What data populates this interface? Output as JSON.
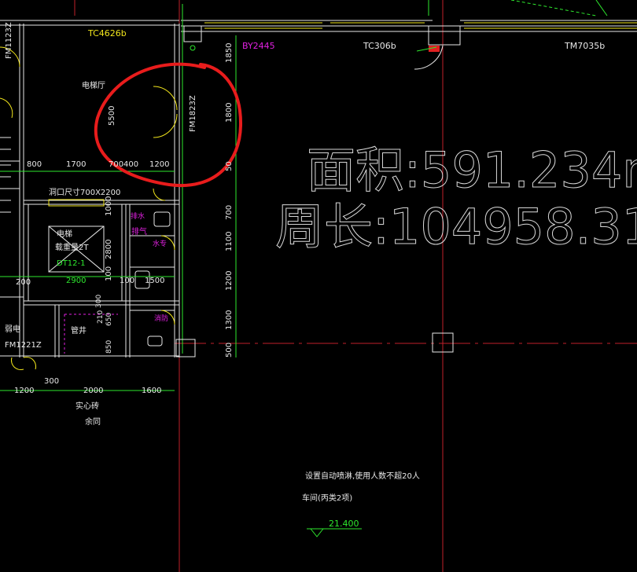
{
  "drawing": {
    "area_label": "面积:591.234m",
    "perimeter_label": "周长:104958.31r",
    "top_labels": {
      "tc4626b": "TC4626b",
      "by2445": "BY2445",
      "tc306b": "TC306b",
      "tm7035b": "TM7035b"
    },
    "left_labels": {
      "fm1123z": "FM1123Z",
      "elevator_hall": "电梯厅",
      "fm1823z": "FM1823Z",
      "dim_5500": "5500",
      "opening_size": "洞口尺寸700X2200",
      "elevator": "电梯",
      "elevator_load": "载重量2T",
      "dt12": "DT12-1",
      "weak_current": "弱电",
      "fm1221z": "FM1221Z",
      "sewer": "排水",
      "pipe_well": "管井",
      "exhaust": "排气",
      "water": "水专",
      "fire_room": "消防",
      "solid_brick": "实心砖",
      "remaining": "余同"
    },
    "dimensions": {
      "row1": [
        "800",
        "1700",
        "700",
        "400",
        "1200"
      ],
      "row_bottom": [
        "1200",
        "300",
        "2000",
        "1600"
      ],
      "row_mid": [
        "200",
        "2900",
        "100",
        "1500"
      ],
      "vertical_right": [
        "1850",
        "1800",
        "50",
        "700",
        "1100",
        "1200",
        "1300",
        "500"
      ],
      "vertical_mid": [
        "1000",
        "2800",
        "100"
      ],
      "vertical_left": [
        "300",
        "650",
        "210",
        "850"
      ]
    },
    "notes": {
      "sprinkler": "设置自动喷淋,使用人数不超20人",
      "garage": "车间(丙类2项)",
      "elevation": "21.400"
    }
  }
}
